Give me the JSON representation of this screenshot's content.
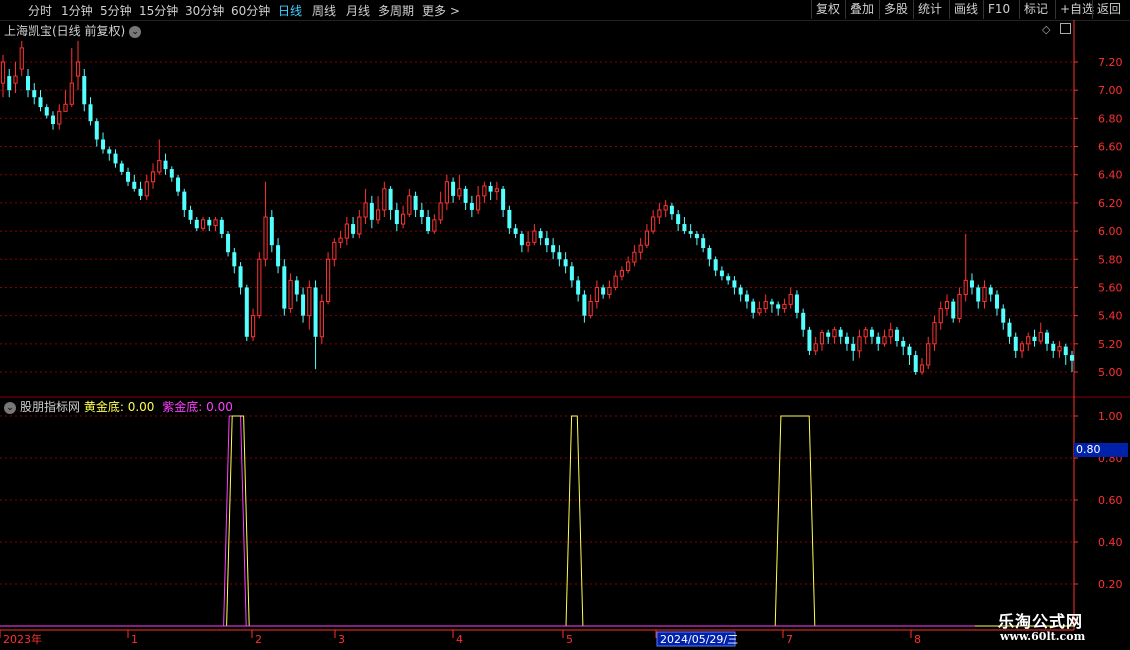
{
  "period_bar": {
    "items": [
      {
        "label": "分时",
        "active": false
      },
      {
        "label": "1分钟",
        "active": false
      },
      {
        "label": "5分钟",
        "active": false
      },
      {
        "label": "15分钟",
        "active": false
      },
      {
        "label": "30分钟",
        "active": false
      },
      {
        "label": "60分钟",
        "active": false
      },
      {
        "label": "日线",
        "active": true
      },
      {
        "label": "周线",
        "active": false
      },
      {
        "label": "月线",
        "active": false
      },
      {
        "label": "多周期",
        "active": false
      },
      {
        "label": "更多 >",
        "active": false
      }
    ]
  },
  "tool_buttons": [
    "复权",
    "叠加",
    "多股",
    "统计",
    "画线",
    "F10",
    "标记",
    "+自选",
    "返回"
  ],
  "main_title": "上海凯宝(日线 前复权)",
  "indicator": {
    "name": "股朋指标网",
    "gold_label": "黄金底:",
    "gold_value": "0.00",
    "purple_label": "紫金底:",
    "purple_value": "0.00",
    "cursor_value": "0.80"
  },
  "colors": {
    "up": "#ff3232",
    "down": "#54ffff",
    "gold": "#ffff50",
    "purple": "#ff40ff",
    "grid": "#8b0000",
    "axis": "#ff3030"
  },
  "price_axis": [
    "7.20",
    "7.00",
    "6.80",
    "6.60",
    "6.40",
    "6.20",
    "6.00",
    "5.80",
    "5.60",
    "5.40",
    "5.20",
    "5.00"
  ],
  "indicator_axis": [
    "1.00",
    "0.80",
    "0.60",
    "0.40",
    "0.20"
  ],
  "time_axis": [
    "2023年",
    "1",
    "2",
    "3",
    "4",
    "5",
    "2024/05/29/三",
    "7",
    "8"
  ],
  "watermark": {
    "line1": "乐淘公式网",
    "line2": "www.60lt.com"
  },
  "chart_data": [
    {
      "type": "candlestick",
      "title": "上海凯宝(日线 前复权)",
      "ylim": [
        4.95,
        7.3
      ],
      "candles": [
        [
          7.05,
          7.2,
          7.25,
          6.95
        ],
        [
          7.1,
          7.0,
          7.15,
          6.95
        ],
        [
          7.05,
          7.1,
          7.2,
          6.98
        ],
        [
          7.15,
          7.3,
          7.35,
          7.1
        ],
        [
          7.1,
          7.0,
          7.15,
          6.95
        ],
        [
          7.0,
          6.95,
          7.05,
          6.9
        ],
        [
          6.95,
          6.88,
          7.0,
          6.85
        ],
        [
          6.88,
          6.82,
          6.9,
          6.8
        ],
        [
          6.82,
          6.76,
          6.85,
          6.72
        ],
        [
          6.76,
          6.85,
          6.9,
          6.72
        ],
        [
          6.85,
          6.9,
          7.0,
          6.85
        ],
        [
          6.9,
          7.05,
          7.3,
          6.88
        ],
        [
          7.1,
          7.2,
          7.35,
          7.0
        ],
        [
          7.1,
          6.9,
          7.15,
          6.85
        ],
        [
          6.9,
          6.78,
          6.95,
          6.75
        ],
        [
          6.78,
          6.65,
          6.8,
          6.6
        ],
        [
          6.65,
          6.58,
          6.7,
          6.55
        ],
        [
          6.58,
          6.55,
          6.6,
          6.5
        ],
        [
          6.55,
          6.48,
          6.58,
          6.45
        ],
        [
          6.48,
          6.42,
          6.5,
          6.4
        ],
        [
          6.42,
          6.35,
          6.45,
          6.32
        ],
        [
          6.35,
          6.3,
          6.4,
          6.28
        ],
        [
          6.3,
          6.25,
          6.35,
          6.22
        ],
        [
          6.25,
          6.35,
          6.4,
          6.22
        ],
        [
          6.35,
          6.42,
          6.48,
          6.3
        ],
        [
          6.42,
          6.5,
          6.65,
          6.4
        ],
        [
          6.5,
          6.44,
          6.55,
          6.4
        ],
        [
          6.44,
          6.38,
          6.46,
          6.35
        ],
        [
          6.38,
          6.28,
          6.4,
          6.25
        ],
        [
          6.28,
          6.15,
          6.3,
          6.1
        ],
        [
          6.15,
          6.08,
          6.18,
          6.05
        ],
        [
          6.08,
          6.02,
          6.1,
          6.0
        ],
        [
          6.02,
          6.08,
          6.1,
          6.0
        ],
        [
          6.08,
          6.04,
          6.1,
          6.0
        ],
        [
          6.04,
          6.08,
          6.1,
          6.0
        ],
        [
          6.08,
          5.98,
          6.1,
          5.95
        ],
        [
          5.98,
          5.85,
          6.0,
          5.82
        ],
        [
          5.85,
          5.75,
          5.88,
          5.7
        ],
        [
          5.75,
          5.6,
          5.78,
          5.55
        ],
        [
          5.6,
          5.25,
          5.62,
          5.22
        ],
        [
          5.25,
          5.4,
          5.45,
          5.22
        ],
        [
          5.4,
          5.8,
          5.85,
          5.38
        ],
        [
          5.8,
          6.1,
          6.35,
          5.75
        ],
        [
          6.1,
          5.9,
          6.15,
          5.85
        ],
        [
          5.9,
          5.75,
          5.95,
          5.7
        ],
        [
          5.75,
          5.45,
          5.8,
          5.4
        ],
        [
          5.45,
          5.65,
          5.7,
          5.42
        ],
        [
          5.65,
          5.55,
          5.68,
          5.5
        ],
        [
          5.55,
          5.4,
          5.6,
          5.35
        ],
        [
          5.4,
          5.6,
          5.65,
          5.3
        ],
        [
          5.6,
          5.25,
          5.65,
          5.02
        ],
        [
          5.25,
          5.5,
          5.55,
          5.2
        ],
        [
          5.5,
          5.8,
          5.85,
          5.48
        ],
        [
          5.8,
          5.92,
          5.95,
          5.75
        ],
        [
          5.92,
          5.95,
          6.0,
          5.88
        ],
        [
          5.95,
          6.05,
          6.1,
          5.9
        ],
        [
          6.05,
          5.98,
          6.1,
          5.95
        ],
        [
          5.98,
          6.1,
          6.15,
          5.95
        ],
        [
          6.1,
          6.2,
          6.3,
          6.05
        ],
        [
          6.2,
          6.08,
          6.25,
          6.02
        ],
        [
          6.08,
          6.15,
          6.25,
          6.05
        ],
        [
          6.15,
          6.3,
          6.35,
          6.1
        ],
        [
          6.3,
          6.15,
          6.32,
          6.08
        ],
        [
          6.15,
          6.05,
          6.2,
          6.0
        ],
        [
          6.05,
          6.12,
          6.18,
          6.02
        ],
        [
          6.12,
          6.25,
          6.3,
          6.1
        ],
        [
          6.25,
          6.15,
          6.28,
          6.1
        ],
        [
          6.15,
          6.1,
          6.2,
          6.05
        ],
        [
          6.1,
          6.0,
          6.15,
          5.98
        ],
        [
          6.0,
          6.08,
          6.12,
          5.98
        ],
        [
          6.08,
          6.2,
          6.28,
          6.05
        ],
        [
          6.2,
          6.35,
          6.4,
          6.15
        ],
        [
          6.35,
          6.25,
          6.38,
          6.2
        ],
        [
          6.25,
          6.3,
          6.4,
          6.22
        ],
        [
          6.3,
          6.2,
          6.32,
          6.15
        ],
        [
          6.2,
          6.15,
          6.25,
          6.1
        ],
        [
          6.15,
          6.25,
          6.32,
          6.12
        ],
        [
          6.25,
          6.32,
          6.35,
          6.2
        ],
        [
          6.32,
          6.28,
          6.35,
          6.22
        ],
        [
          6.28,
          6.3,
          6.35,
          6.22
        ],
        [
          6.3,
          6.15,
          6.32,
          6.1
        ],
        [
          6.15,
          6.02,
          6.18,
          5.98
        ],
        [
          6.02,
          5.98,
          6.05,
          5.95
        ],
        [
          5.98,
          5.9,
          6.0,
          5.85
        ],
        [
          5.9,
          5.92,
          6.0,
          5.85
        ],
        [
          5.92,
          6.0,
          6.05,
          5.9
        ],
        [
          6.0,
          5.95,
          6.02,
          5.9
        ],
        [
          5.95,
          5.9,
          6.0,
          5.85
        ],
        [
          5.9,
          5.85,
          5.95,
          5.8
        ],
        [
          5.85,
          5.8,
          5.9,
          5.75
        ],
        [
          5.8,
          5.75,
          5.85,
          5.7
        ],
        [
          5.75,
          5.65,
          5.78,
          5.6
        ],
        [
          5.65,
          5.55,
          5.68,
          5.5
        ],
        [
          5.55,
          5.4,
          5.58,
          5.35
        ],
        [
          5.4,
          5.5,
          5.55,
          5.38
        ],
        [
          5.5,
          5.6,
          5.65,
          5.45
        ],
        [
          5.6,
          5.55,
          5.62,
          5.52
        ],
        [
          5.55,
          5.6,
          5.65,
          5.52
        ],
        [
          5.6,
          5.68,
          5.72,
          5.58
        ],
        [
          5.68,
          5.72,
          5.75,
          5.65
        ],
        [
          5.72,
          5.78,
          5.82,
          5.7
        ],
        [
          5.78,
          5.85,
          5.9,
          5.75
        ],
        [
          5.85,
          5.9,
          5.95,
          5.8
        ],
        [
          5.9,
          6.0,
          6.05,
          5.88
        ],
        [
          6.0,
          6.1,
          6.15,
          5.98
        ],
        [
          6.1,
          6.15,
          6.2,
          6.05
        ],
        [
          6.15,
          6.18,
          6.22,
          6.1
        ],
        [
          6.18,
          6.12,
          6.2,
          6.08
        ],
        [
          6.12,
          6.05,
          6.15,
          6.0
        ],
        [
          6.05,
          6.0,
          6.1,
          5.98
        ],
        [
          6.0,
          5.98,
          6.05,
          5.95
        ],
        [
          5.98,
          5.95,
          6.0,
          5.9
        ],
        [
          5.95,
          5.88,
          5.98,
          5.85
        ],
        [
          5.88,
          5.8,
          5.9,
          5.75
        ],
        [
          5.8,
          5.72,
          5.82,
          5.68
        ],
        [
          5.72,
          5.68,
          5.75,
          5.65
        ],
        [
          5.68,
          5.65,
          5.7,
          5.62
        ],
        [
          5.65,
          5.6,
          5.68,
          5.55
        ],
        [
          5.6,
          5.55,
          5.62,
          5.5
        ],
        [
          5.55,
          5.5,
          5.58,
          5.45
        ],
        [
          5.5,
          5.42,
          5.52,
          5.38
        ],
        [
          5.42,
          5.45,
          5.5,
          5.4
        ],
        [
          5.45,
          5.5,
          5.55,
          5.42
        ],
        [
          5.5,
          5.48,
          5.52,
          5.42
        ],
        [
          5.48,
          5.45,
          5.5,
          5.4
        ],
        [
          5.45,
          5.48,
          5.52,
          5.42
        ],
        [
          5.48,
          5.55,
          5.6,
          5.45
        ],
        [
          5.55,
          5.42,
          5.58,
          5.38
        ],
        [
          5.42,
          5.3,
          5.45,
          5.25
        ],
        [
          5.3,
          5.15,
          5.32,
          5.12
        ],
        [
          5.15,
          5.2,
          5.25,
          5.12
        ],
        [
          5.2,
          5.28,
          5.3,
          5.15
        ],
        [
          5.28,
          5.25,
          5.3,
          5.2
        ],
        [
          5.25,
          5.3,
          5.32,
          5.2
        ],
        [
          5.3,
          5.25,
          5.32,
          5.2
        ],
        [
          5.25,
          5.2,
          5.28,
          5.15
        ],
        [
          5.2,
          5.15,
          5.25,
          5.08
        ],
        [
          5.15,
          5.25,
          5.3,
          5.1
        ],
        [
          5.25,
          5.3,
          5.32,
          5.2
        ],
        [
          5.3,
          5.25,
          5.32,
          5.2
        ],
        [
          5.25,
          5.2,
          5.28,
          5.15
        ],
        [
          5.2,
          5.25,
          5.3,
          5.18
        ],
        [
          5.25,
          5.3,
          5.35,
          5.2
        ],
        [
          5.3,
          5.22,
          5.32,
          5.18
        ],
        [
          5.22,
          5.18,
          5.25,
          5.12
        ],
        [
          5.18,
          5.12,
          5.2,
          5.05
        ],
        [
          5.12,
          5.0,
          5.15,
          4.98
        ],
        [
          5.0,
          5.05,
          5.1,
          4.98
        ],
        [
          5.05,
          5.2,
          5.25,
          5.02
        ],
        [
          5.2,
          5.35,
          5.4,
          5.15
        ],
        [
          5.35,
          5.45,
          5.5,
          5.3
        ],
        [
          5.45,
          5.5,
          5.55,
          5.4
        ],
        [
          5.5,
          5.38,
          5.52,
          5.35
        ],
        [
          5.38,
          5.55,
          5.6,
          5.35
        ],
        [
          5.55,
          5.65,
          5.98,
          5.5
        ],
        [
          5.65,
          5.6,
          5.7,
          5.55
        ],
        [
          5.6,
          5.5,
          5.62,
          5.45
        ],
        [
          5.5,
          5.6,
          5.65,
          5.45
        ],
        [
          5.6,
          5.55,
          5.62,
          5.5
        ],
        [
          5.55,
          5.45,
          5.58,
          5.4
        ],
        [
          5.45,
          5.35,
          5.48,
          5.3
        ],
        [
          5.35,
          5.25,
          5.38,
          5.2
        ],
        [
          5.25,
          5.15,
          5.28,
          5.1
        ],
        [
          5.15,
          5.2,
          5.22,
          5.1
        ],
        [
          5.2,
          5.25,
          5.28,
          5.15
        ],
        [
          5.25,
          5.22,
          5.3,
          5.18
        ],
        [
          5.22,
          5.28,
          5.35,
          5.2
        ],
        [
          5.28,
          5.2,
          5.3,
          5.15
        ],
        [
          5.2,
          5.15,
          5.22,
          5.1
        ],
        [
          5.15,
          5.18,
          5.22,
          5.1
        ],
        [
          5.18,
          5.12,
          5.2,
          5.05
        ],
        [
          5.12,
          5.08,
          5.15,
          5.0
        ]
      ],
      "xticks": [
        "2023年",
        "1",
        "2",
        "3",
        "4",
        "5",
        "2024/05/29/三",
        "7",
        "8"
      ],
      "yticks": [
        7.2,
        7.0,
        6.8,
        6.6,
        6.4,
        6.2,
        6.0,
        5.8,
        5.6,
        5.4,
        5.2,
        5.0
      ],
      "grid": true
    },
    {
      "type": "line",
      "title": "股朋指标网",
      "ylim": [
        0,
        1
      ],
      "yticks": [
        1.0,
        0.8,
        0.6,
        0.4,
        0.2
      ],
      "series": [
        {
          "name": "黄金底",
          "color": "#ffff50",
          "pulses": [
            [
              40,
              42
            ],
            [
              100,
              101
            ],
            [
              137,
              142
            ]
          ]
        },
        {
          "name": "紫金底",
          "color": "#ff40ff",
          "pulses": [
            [
              40,
              42
            ]
          ]
        }
      ],
      "n_points": 190
    }
  ]
}
